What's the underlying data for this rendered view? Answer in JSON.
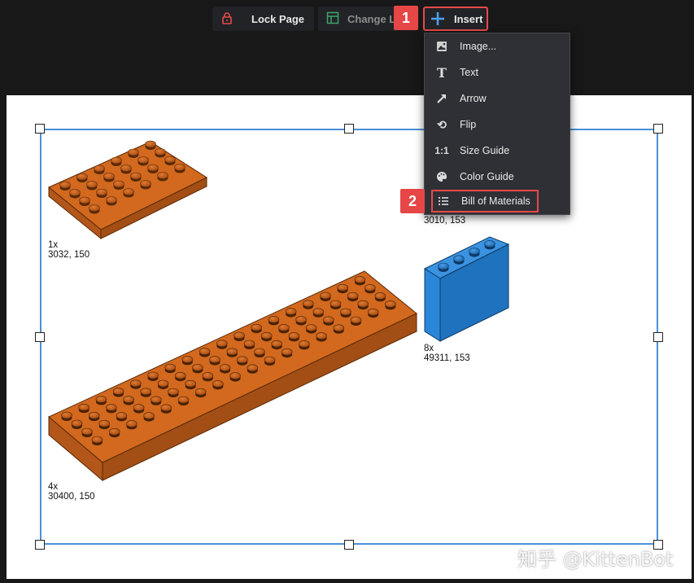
{
  "toolbar": {
    "lock_label": "Lock Page",
    "layout_label": "Change La",
    "insert_label": "Insert"
  },
  "steps": {
    "one": "1",
    "two": "2"
  },
  "menu": {
    "items": [
      {
        "icon": "image-icon",
        "label": "Image..."
      },
      {
        "icon": "text-icon",
        "glyph": "T",
        "label": "Text"
      },
      {
        "icon": "arrow-icon",
        "label": "Arrow"
      },
      {
        "icon": "flip-icon",
        "glyph": "⟲",
        "label": "Flip"
      },
      {
        "icon": "size-guide-icon",
        "glyph": "1:1",
        "label": "Size Guide"
      },
      {
        "icon": "palette-icon",
        "label": "Color Guide"
      },
      {
        "icon": "list-icon",
        "label": "Bill of Materials"
      }
    ]
  },
  "parts": [
    {
      "qty": "1x",
      "id": "3032, 150",
      "color": "#d2691e"
    },
    {
      "qty": "",
      "id": "3010, 153",
      "color": "#2a86d8"
    },
    {
      "qty": "8x",
      "id": "49311, 153",
      "color": "#2a86d8"
    },
    {
      "qty": "4x",
      "id": "30400, 150",
      "color": "#d2691e"
    }
  ],
  "colors": {
    "accent": "#e84a4a",
    "selection": "#4a90d9",
    "brick_orange": "#d2691e",
    "brick_blue": "#2a86d8"
  },
  "watermark": "知乎 @KittenBot"
}
